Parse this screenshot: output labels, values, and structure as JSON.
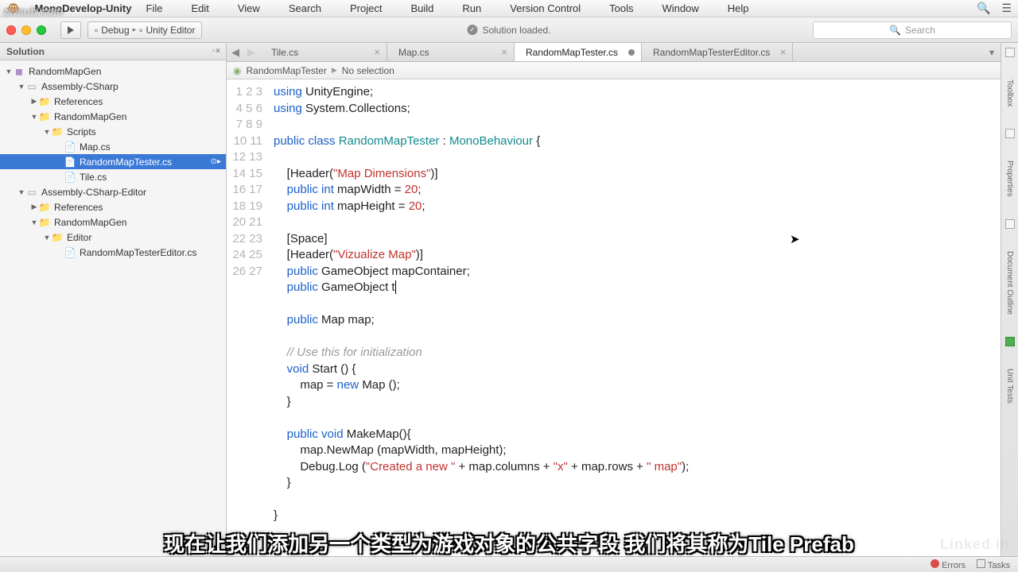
{
  "menubar": {
    "app": "MonoDevelop-Unity",
    "items": [
      "File",
      "Edit",
      "View",
      "Search",
      "Project",
      "Build",
      "Run",
      "Version Control",
      "Tools",
      "Window",
      "Help"
    ]
  },
  "toolbar": {
    "debug": "Debug",
    "target": "Unity Editor",
    "status": "Solution loaded.",
    "search_placeholder": "Search"
  },
  "solution": {
    "title": "Solution",
    "rows": [
      {
        "depth": 0,
        "arrow": "▼",
        "icon": "◼",
        "cls": "projico",
        "label": "RandomMapGen",
        "interact": true
      },
      {
        "depth": 1,
        "arrow": "▼",
        "icon": "▭",
        "cls": "fldr",
        "label": "Assembly-CSharp",
        "interact": true
      },
      {
        "depth": 2,
        "arrow": "▶",
        "icon": "📁",
        "cls": "fldr",
        "label": "References",
        "interact": true
      },
      {
        "depth": 2,
        "arrow": "▼",
        "icon": "📁",
        "cls": "fldr",
        "label": "RandomMapGen",
        "interact": true
      },
      {
        "depth": 3,
        "arrow": "▼",
        "icon": "📁",
        "cls": "fldr",
        "label": "Scripts",
        "interact": true
      },
      {
        "depth": 4,
        "arrow": "",
        "icon": "📄",
        "cls": "csico",
        "label": "Map.cs",
        "interact": true
      },
      {
        "depth": 4,
        "arrow": "",
        "icon": "📄",
        "cls": "csico",
        "label": "RandomMapTester.cs",
        "interact": true,
        "selected": true
      },
      {
        "depth": 4,
        "arrow": "",
        "icon": "📄",
        "cls": "csico",
        "label": "Tile.cs",
        "interact": true
      },
      {
        "depth": 1,
        "arrow": "▼",
        "icon": "▭",
        "cls": "fldr",
        "label": "Assembly-CSharp-Editor",
        "interact": true
      },
      {
        "depth": 2,
        "arrow": "▶",
        "icon": "📁",
        "cls": "fldr",
        "label": "References",
        "interact": true
      },
      {
        "depth": 2,
        "arrow": "▼",
        "icon": "📁",
        "cls": "fldr",
        "label": "RandomMapGen",
        "interact": true
      },
      {
        "depth": 3,
        "arrow": "▼",
        "icon": "📁",
        "cls": "fldr",
        "label": "Editor",
        "interact": true
      },
      {
        "depth": 4,
        "arrow": "",
        "icon": "📄",
        "cls": "csico",
        "label": "RandomMapTesterEditor.cs",
        "interact": true
      }
    ]
  },
  "tabs": [
    {
      "label": "Tile.cs",
      "active": false,
      "dirty": false,
      "close": true
    },
    {
      "label": "Map.cs",
      "active": false,
      "dirty": false,
      "close": true
    },
    {
      "label": "RandomMapTester.cs",
      "active": true,
      "dirty": true,
      "close": false
    },
    {
      "label": "RandomMapTesterEditor.cs",
      "active": false,
      "dirty": false,
      "close": true
    }
  ],
  "breadcrumb": {
    "class": "RandomMapTester",
    "detail": "No selection"
  },
  "code_lines": [
    [
      {
        "t": "using ",
        "c": "k-blue"
      },
      {
        "t": "UnityEngine;"
      }
    ],
    [
      {
        "t": "using ",
        "c": "k-blue"
      },
      {
        "t": "System.Collections;"
      }
    ],
    [],
    [
      {
        "t": "public class ",
        "c": "k-blue"
      },
      {
        "t": "RandomMapTester",
        "c": "k-teal"
      },
      {
        "t": " : "
      },
      {
        "t": "MonoBehaviour",
        "c": "k-teal"
      },
      {
        "t": " {"
      }
    ],
    [],
    [
      {
        "t": "    [Header("
      },
      {
        "t": "\"Map Dimensions\"",
        "c": "k-str"
      },
      {
        "t": ")]"
      }
    ],
    [
      {
        "t": "    "
      },
      {
        "t": "public int ",
        "c": "k-blue"
      },
      {
        "t": "mapWidth = "
      },
      {
        "t": "20",
        "c": "k-str"
      },
      {
        "t": ";"
      }
    ],
    [
      {
        "t": "    "
      },
      {
        "t": "public int ",
        "c": "k-blue"
      },
      {
        "t": "mapHeight = "
      },
      {
        "t": "20",
        "c": "k-str"
      },
      {
        "t": ";"
      }
    ],
    [],
    [
      {
        "t": "    [Space]"
      }
    ],
    [
      {
        "t": "    [Header("
      },
      {
        "t": "\"Vizualize Map\"",
        "c": "k-str"
      },
      {
        "t": ")]"
      }
    ],
    [
      {
        "t": "    "
      },
      {
        "t": "public ",
        "c": "k-blue"
      },
      {
        "t": "GameObject mapContainer;"
      }
    ],
    [
      {
        "t": "    "
      },
      {
        "t": "public ",
        "c": "k-blue"
      },
      {
        "t": "GameObject t"
      },
      {
        "t": "",
        "cursor": true
      }
    ],
    [],
    [
      {
        "t": "    "
      },
      {
        "t": "public ",
        "c": "k-blue"
      },
      {
        "t": "Map map;"
      }
    ],
    [],
    [
      {
        "t": "    "
      },
      {
        "t": "// Use this for initialization",
        "c": "k-cmt"
      }
    ],
    [
      {
        "t": "    "
      },
      {
        "t": "void ",
        "c": "k-blue"
      },
      {
        "t": "Start () {"
      }
    ],
    [
      {
        "t": "        map = "
      },
      {
        "t": "new ",
        "c": "k-blue"
      },
      {
        "t": "Map ();"
      }
    ],
    [
      {
        "t": "    }"
      }
    ],
    [],
    [
      {
        "t": "    "
      },
      {
        "t": "public void ",
        "c": "k-blue"
      },
      {
        "t": "MakeMap(){"
      }
    ],
    [
      {
        "t": "        map.NewMap (mapWidth, mapHeight);"
      }
    ],
    [
      {
        "t": "        Debug.Log ("
      },
      {
        "t": "\"Created a new \"",
        "c": "k-str"
      },
      {
        "t": " + map.columns + "
      },
      {
        "t": "\"x\"",
        "c": "k-str"
      },
      {
        "t": " + map.rows + "
      },
      {
        "t": "\" map\"",
        "c": "k-str"
      },
      {
        "t": ");"
      }
    ],
    [
      {
        "t": "    }"
      }
    ],
    [],
    [
      {
        "t": "}"
      }
    ]
  ],
  "rightrail": [
    "Toolbox",
    "Properties",
    "Document Outline",
    "Unit Tests"
  ],
  "statusbar": {
    "errors": "Errors",
    "tasks": "Tasks"
  },
  "subtitle": "现在让我们添加另一个类型为游戏对象的公共字段 我们将其称为Tile Prefab",
  "watermark": "zwsub.com",
  "brand": "Linked in"
}
